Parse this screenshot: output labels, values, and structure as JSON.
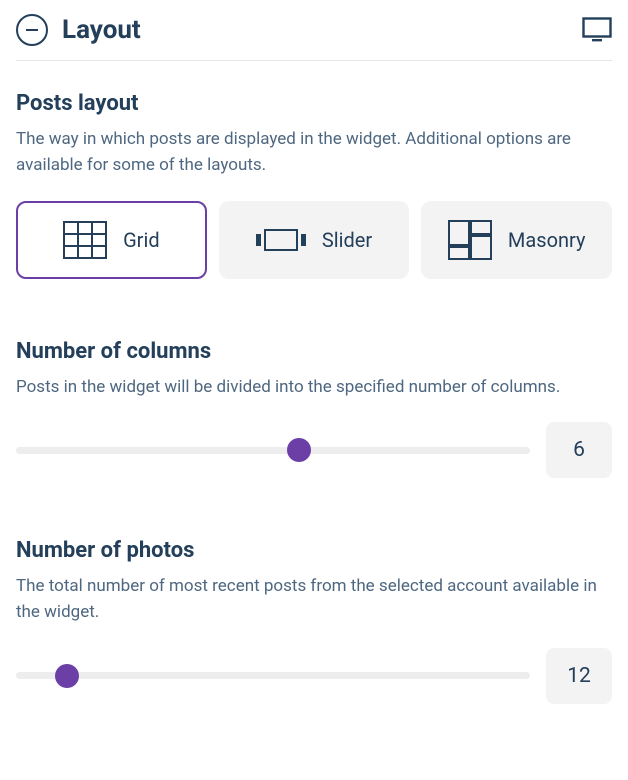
{
  "header": {
    "title": "Layout"
  },
  "postsLayout": {
    "title": "Posts layout",
    "desc": "The way in which posts are displayed in the widget. Additional options are available for some of the layouts.",
    "options": {
      "grid": "Grid",
      "slider": "Slider",
      "masonry": "Masonry"
    }
  },
  "columns": {
    "title": "Number of columns",
    "desc": "Posts in the widget will be divided into the specified number of columns.",
    "value": "6"
  },
  "photos": {
    "title": "Number of photos",
    "desc": "The total number of most recent posts from the selected account available in the widget.",
    "value": "12"
  }
}
